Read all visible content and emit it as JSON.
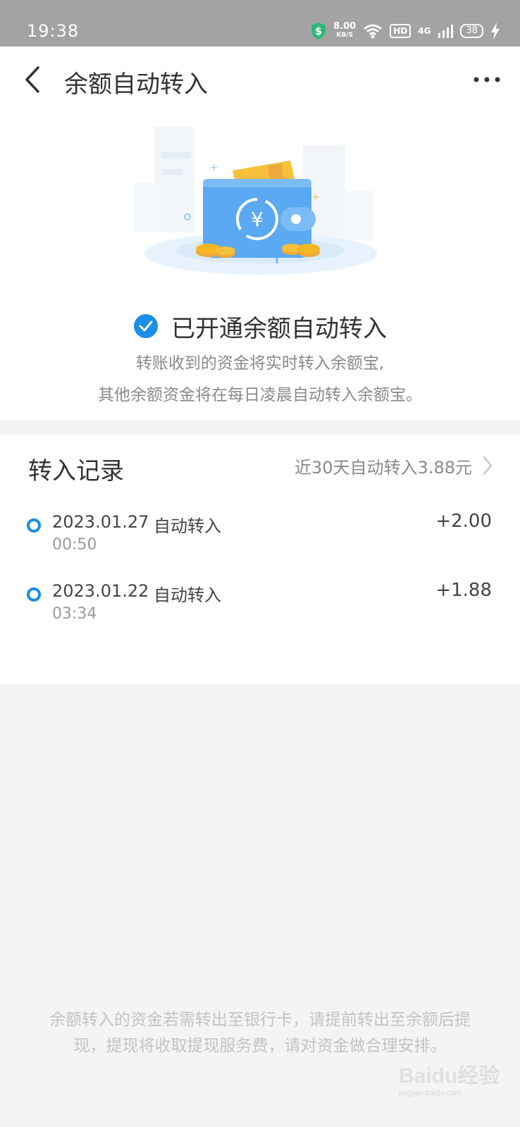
{
  "status_bar": {
    "time": "19:38",
    "speed_value": "8.00",
    "speed_unit": "KB/S",
    "hd": "HD",
    "network": "4G",
    "battery": "38"
  },
  "header": {
    "title": "余额自动转入"
  },
  "hero": {
    "enabled_title": "已开通余额自动转入",
    "desc_line1": "转账收到的资金将实时转入余额宝,",
    "desc_line2": "其他余额资金将在每日凌晨自动转入余额宝。"
  },
  "records": {
    "title": "转入记录",
    "summary": "近30天自动转入3.88元",
    "items": [
      {
        "date": "2023.01.27",
        "type": "自动转入",
        "time": "00:50",
        "amount": "+2.00"
      },
      {
        "date": "2023.01.22",
        "type": "自动转入",
        "time": "03:34",
        "amount": "+1.88"
      }
    ]
  },
  "footer": {
    "note": "余额转入的资金若需转出至银行卡，请提前转出至余额后提现，提现将收取提现服务费，请对资金做合理安排。"
  },
  "watermark": {
    "text": "Baidu经验",
    "sub": "jingyan.baidu.com"
  },
  "colors": {
    "accent": "#1a8fe8",
    "wallet": "#5aa9f2",
    "coin": "#f5b623",
    "status_bar": "#a3a3a3",
    "page_bg": "#f4f4f4"
  },
  "icons": [
    "shield-icon",
    "wifi-icon",
    "signal-icon",
    "charging-icon",
    "back-arrow-icon",
    "more-icon",
    "wallet-illustration",
    "check-circle-icon",
    "chevron-right-icon",
    "timeline-dot-icon"
  ]
}
